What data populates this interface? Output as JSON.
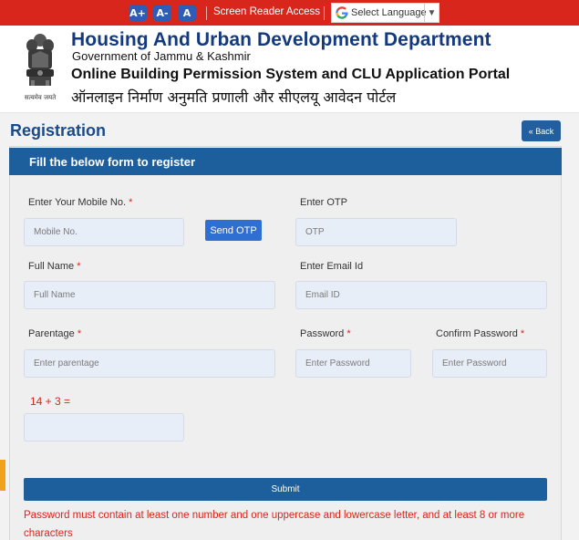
{
  "topbar": {
    "font_increase": "A+",
    "font_decrease": "A-",
    "font_normal": "A",
    "screen_reader": "Screen Reader Access",
    "language_label": "Select Language",
    "language_caret": "▼"
  },
  "header": {
    "department": "Housing And Urban Development Department",
    "government": "Government of Jammu & Kashmir",
    "portal_name": "Online Building Permission System and CLU Application Portal",
    "portal_name_hindi": "ऑनलाइन निर्माण अनुमति प्रणाली और सीएलयू आवेदन पोर्टल",
    "emblem_motto": "सत्यमेव जयते"
  },
  "page": {
    "title": "Registration",
    "back_label": "« Back",
    "panel_heading": "Fill the below form to register"
  },
  "form": {
    "mobile_label": "Enter Your Mobile No.",
    "mobile_placeholder": "Mobile No.",
    "send_otp_label": "Send OTP",
    "otp_label": "Enter OTP",
    "otp_placeholder": "OTP",
    "fullname_label": "Full Name",
    "fullname_placeholder": "Full Name",
    "email_label": "Enter Email Id",
    "email_placeholder": "Email ID",
    "parentage_label": "Parentage",
    "parentage_placeholder": "Enter parentage",
    "password_label": "Password",
    "password_placeholder": "Enter Password",
    "confirm_label": "Confirm Password",
    "confirm_placeholder": "Enter Password",
    "required_mark": "*",
    "captcha_question": "14 + 3 =",
    "submit_label": "Submit",
    "password_note": "Password must contain at least one number and one uppercase and lowercase letter, and at least 8 or more characters"
  },
  "colors": {
    "topbar": "#d9261c",
    "brand_blue": "#14397c",
    "panel_head": "#1d5f9c",
    "error_red": "#d9261c"
  }
}
